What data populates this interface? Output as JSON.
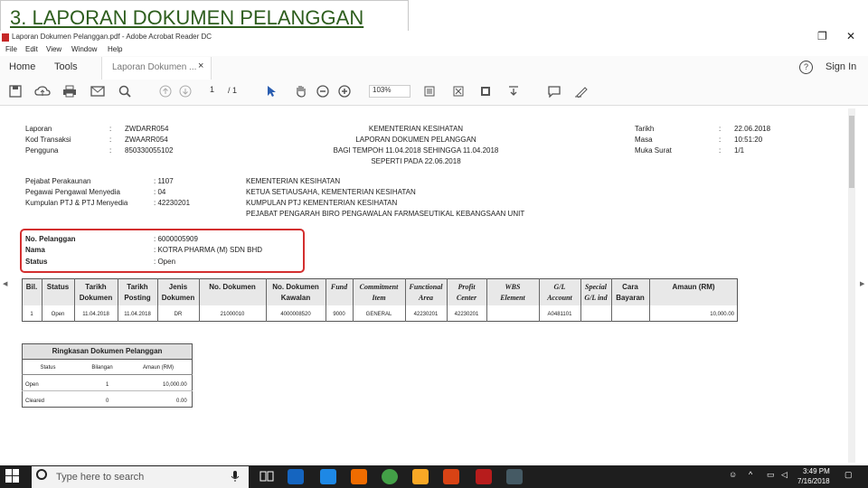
{
  "slide_title": "3. LAPORAN DOKUMEN PELANGGAN",
  "window": {
    "title": "Laporan Dokumen Pelanggan.pdf - Adobe Acrobat Reader DC",
    "restore_glyph": "❐",
    "close_glyph": "✕"
  },
  "menu": [
    "File",
    "Edit",
    "View",
    "Window",
    "Help"
  ],
  "tabs": {
    "home": "Home",
    "tools": "Tools",
    "doc_tab": "Laporan Dokumen ...",
    "close_glyph": "×"
  },
  "toolbar": {
    "page_current": "1",
    "page_total": "/ 1",
    "zoom": "103%",
    "icons": [
      "save-icon",
      "upload-cloud-icon",
      "print-icon",
      "email-icon",
      "search-icon",
      "page-up-icon",
      "page-down-icon",
      "select-arrow-icon",
      "hand-icon",
      "zoom-out-icon",
      "zoom-in-icon",
      "fit-page-icon",
      "fullscreen-icon",
      "rotate-icon",
      "download-icon",
      "comment-icon",
      "sign-pen-icon"
    ]
  },
  "signin": "Sign In",
  "help_glyph": "?",
  "report": {
    "left_header": {
      "labels": [
        "Laporan",
        "Kod Transaksi",
        "Pengguna"
      ],
      "colons": [
        ":",
        ":",
        ":"
      ],
      "values": [
        "ZWDARR054",
        "ZWAARR054",
        "850330055102"
      ]
    },
    "center_header": [
      "KEMENTERIAN KESIHATAN",
      "LAPORAN DOKUMEN PELANGGAN",
      "BAGI TEMPOH 11.04.2018 SEHINGGA 11.04.2018",
      "SEPERTI PADA 22.06.2018"
    ],
    "right_header": {
      "labels": [
        "Tarikh",
        "Masa",
        "Muka Surat"
      ],
      "colons": [
        ":",
        ":",
        ":"
      ],
      "values": [
        "22.06.2018",
        "10:51:20",
        "1/1"
      ]
    },
    "pejabat": {
      "labels": [
        "Pejabat Perakaunan",
        "Pegawai Pengawal Menyedia",
        "Kumpulan PTJ & PTJ Menyedia"
      ],
      "values": [
        ": 1107",
        ": 04",
        ": 42230201"
      ],
      "descriptions": [
        "KEMENTERIAN KESIHATAN",
        "KETUA SETIAUSAHA, KEMENTERIAN KESIHATAN",
        "KUMPULAN PTJ KEMENTERIAN KESIHATAN",
        "PEJABAT PENGARAH BIRO PENGAWALAN FARMASEUTIKAL KEBANGSAAN UNIT"
      ]
    },
    "customer": {
      "labels": [
        "No. Pelanggan",
        "Nama",
        "Status"
      ],
      "values": [
        ": 6000005909",
        ": KOTRA PHARMA (M) SDN BHD",
        ": Open"
      ]
    },
    "table_headers": [
      {
        "l1": "Bil.",
        "l2": ""
      },
      {
        "l1": "Status",
        "l2": ""
      },
      {
        "l1": "Tarikh",
        "l2": "Dokumen"
      },
      {
        "l1": "Tarikh",
        "l2": "Posting"
      },
      {
        "l1": "Jenis",
        "l2": "Dokumen"
      },
      {
        "l1": "No. Dokumen",
        "l2": ""
      },
      {
        "l1": "No. Dokumen",
        "l2": "Kawalan"
      },
      {
        "l1": "Fund",
        "l2": ""
      },
      {
        "l1": "Commitment",
        "l2": "Item"
      },
      {
        "l1": "Functional",
        "l2": "Area"
      },
      {
        "l1": "Profit",
        "l2": "Center"
      },
      {
        "l1": "WBS",
        "l2": "Element"
      },
      {
        "l1": "G/L",
        "l2": "Account"
      },
      {
        "l1": "Special",
        "l2": "G/L ind"
      },
      {
        "l1": "Cara",
        "l2": "Bayaran"
      },
      {
        "l1": "Amaun (RM)",
        "l2": ""
      }
    ],
    "table_row": [
      "1",
      "Open",
      "11.04.2018",
      "11.04.2018",
      "DR",
      "21000010",
      "4000008520",
      "9000",
      "GENERAL",
      "42230201",
      "42230201",
      "",
      "A0481101",
      "",
      "",
      "10,000.00"
    ],
    "summary": {
      "title": "Ringkasan Dokumen Pelanggan",
      "headers": [
        "Status",
        "Bilangan",
        "Amaun (RM)"
      ],
      "rows": [
        [
          "Open",
          "1",
          "10,000.00"
        ],
        [
          "Cleared",
          "0",
          "0.00"
        ]
      ]
    }
  },
  "taskbar": {
    "search_placeholder": "Type here to search",
    "time": "3:49 PM",
    "date": "7/16/2018"
  }
}
